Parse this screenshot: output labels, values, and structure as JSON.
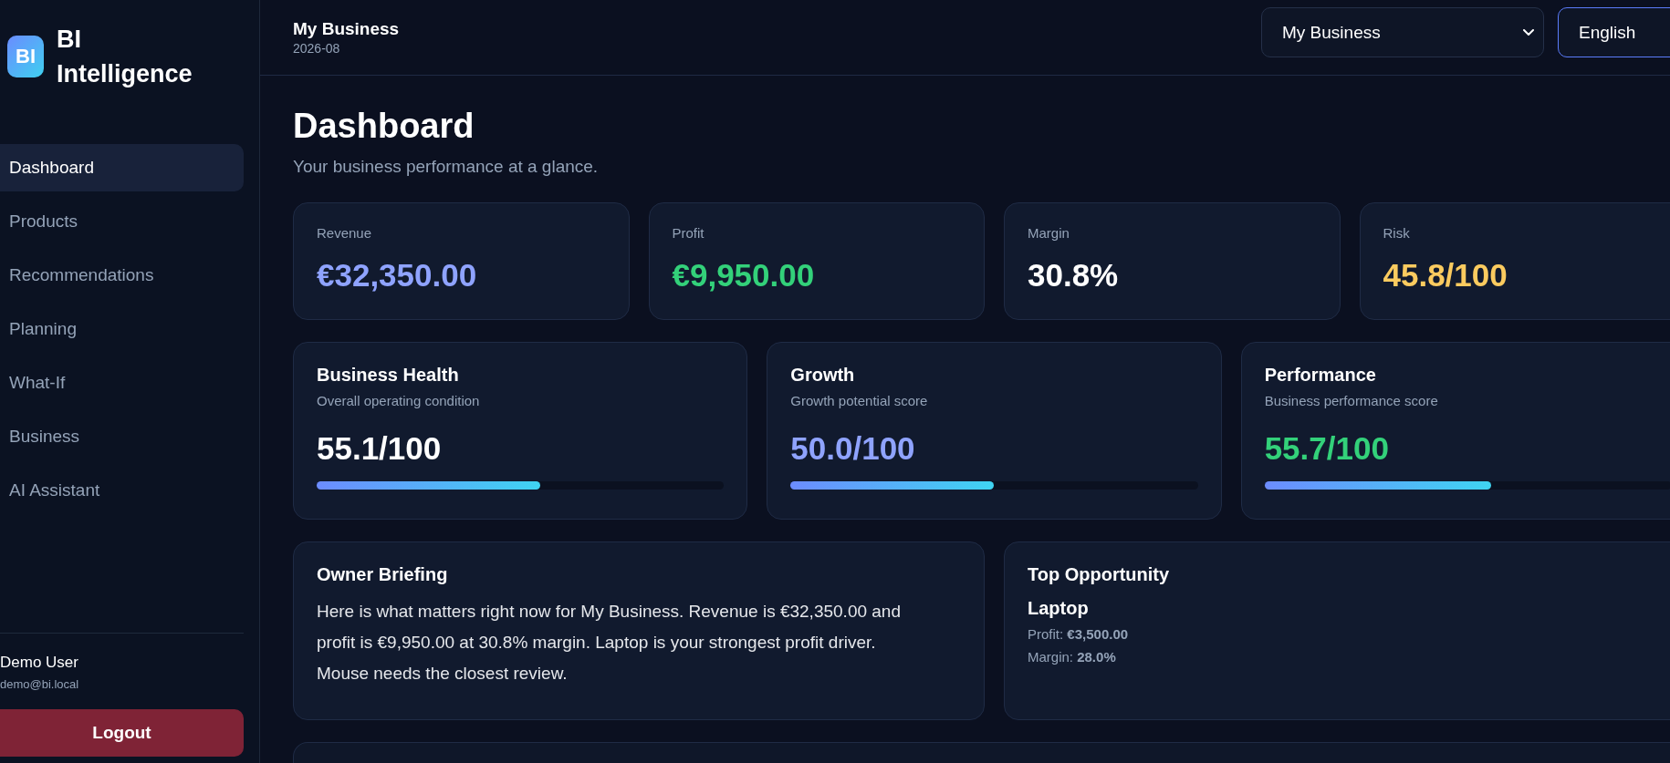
{
  "sidebar": {
    "logo_mark": "BI",
    "brand": "BI Intelligence",
    "items": [
      {
        "label": "Dashboard",
        "selected": true
      },
      {
        "label": "Products",
        "selected": false
      },
      {
        "label": "Recommendations",
        "selected": false
      },
      {
        "label": "Planning",
        "selected": false
      },
      {
        "label": "What-If",
        "selected": false
      },
      {
        "label": "Business",
        "selected": false
      },
      {
        "label": "AI Assistant",
        "selected": false
      }
    ],
    "user": {
      "name": "Demo User",
      "email": "demo@bi.local"
    },
    "logout": "Logout"
  },
  "header": {
    "business": "My Business",
    "period": "2026-08",
    "business_select": "My Business",
    "language_select": "English"
  },
  "page": {
    "title": "Dashboard",
    "subtitle": "Your business performance at a glance."
  },
  "metrics": [
    {
      "label": "Revenue",
      "value": "€32,350.00",
      "color": "#8fa3ff"
    },
    {
      "label": "Profit",
      "value": "€9,950.00",
      "color": "#33d17a"
    },
    {
      "label": "Margin",
      "value": "30.8%",
      "color": "#ffffff"
    },
    {
      "label": "Risk",
      "value": "45.8/100",
      "color": "#fbcb5f"
    }
  ],
  "scores": [
    {
      "title": "Business Health",
      "subtitle": "Overall operating condition",
      "value": "55.1/100",
      "color": "#ffffff",
      "level": 0.55
    },
    {
      "title": "Growth",
      "subtitle": "Growth potential score",
      "value": "50.0/100",
      "color": "#8fa3ff",
      "level": 0.5
    },
    {
      "title": "Performance",
      "subtitle": "Business performance score",
      "value": "55.7/100",
      "color": "#33d17a",
      "level": 0.557
    }
  ],
  "briefing": {
    "title": "Owner Briefing",
    "text": "Here is what matters right now for My Business. Revenue is €32,350.00 and profit is €9,950.00 at 30.8% margin. Laptop is your strongest profit driver. Mouse needs the closest review."
  },
  "opportunity": {
    "title": "Top Opportunity",
    "product": "Laptop",
    "lines": [
      "Profit: **€3,500.00**",
      "Margin: **28.0%**"
    ]
  }
}
